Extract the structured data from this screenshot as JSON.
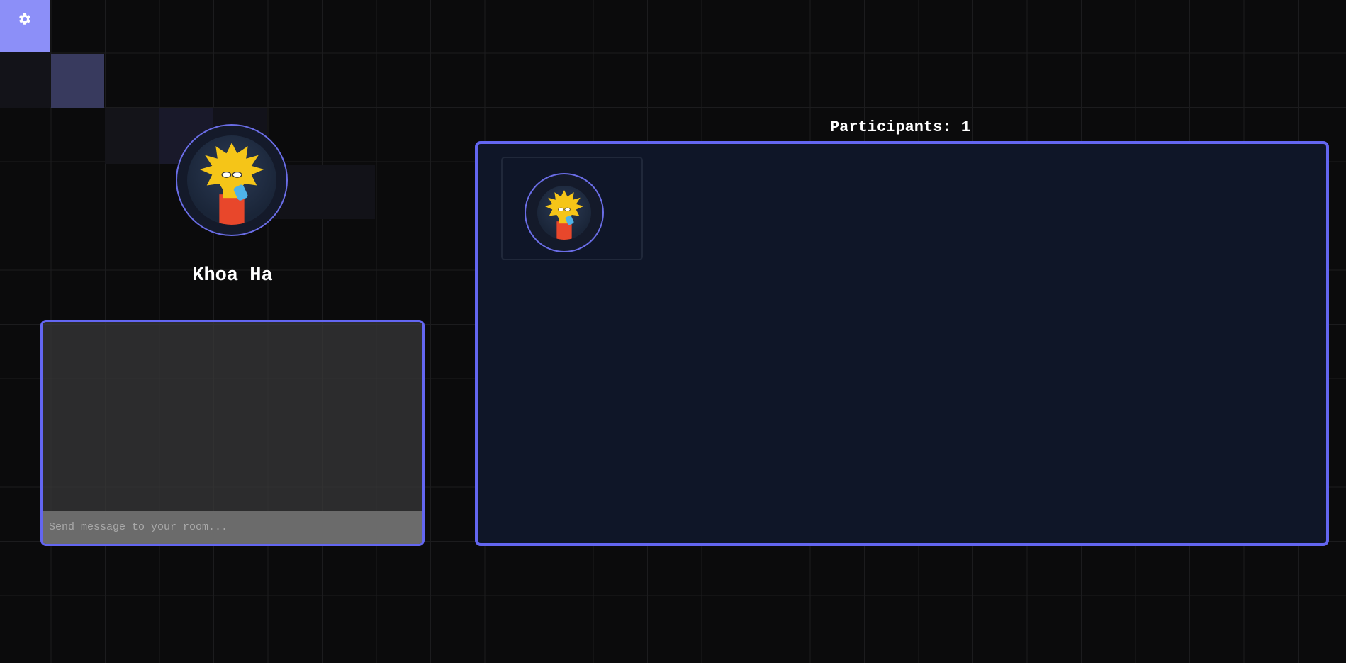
{
  "settings": {
    "icon": "gear-icon",
    "accent": "#8c8ff8"
  },
  "profile": {
    "name": "Khoa Ha",
    "avatar": "cartoon-avatar"
  },
  "chat": {
    "placeholder": "Send message to your room...",
    "value": ""
  },
  "participants": {
    "title": "Participants: 1",
    "list": [
      {
        "avatar": "cartoon-avatar"
      }
    ]
  },
  "colors": {
    "accent": "#6366f1",
    "background": "#0b0b0c",
    "panel": "#0f1628"
  }
}
